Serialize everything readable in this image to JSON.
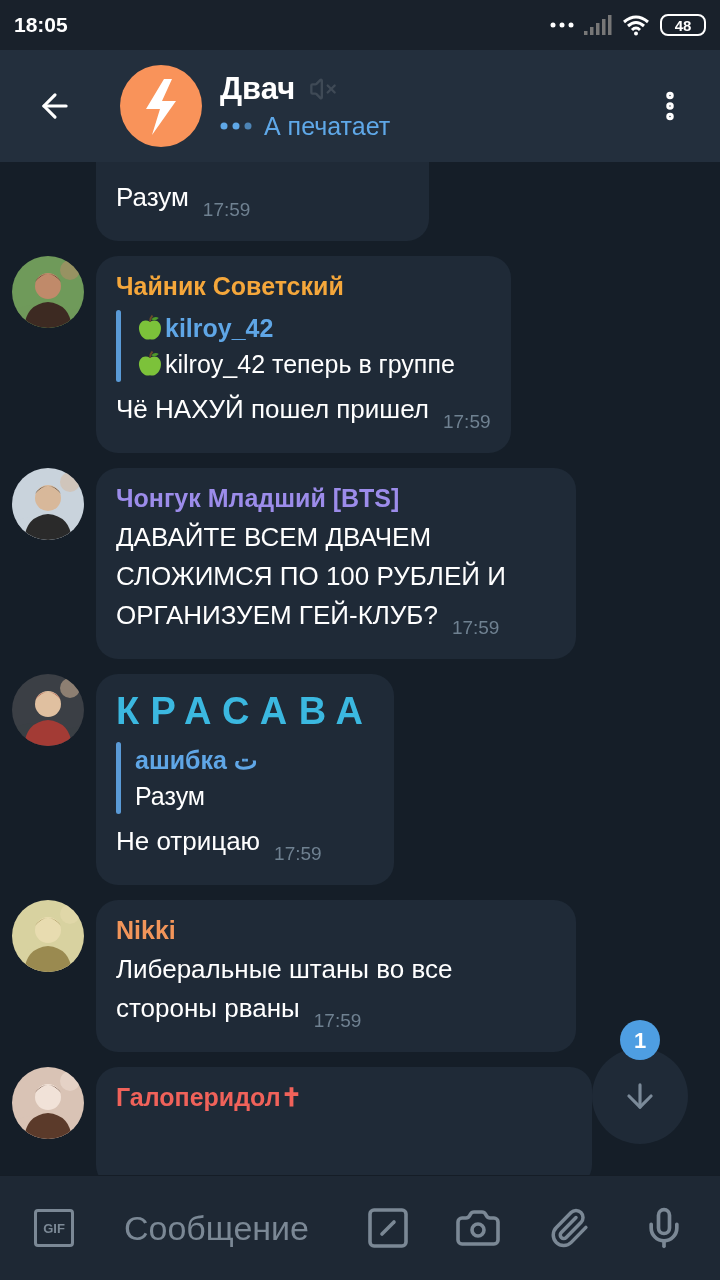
{
  "status_bar": {
    "time": "18:05",
    "battery": "48"
  },
  "header": {
    "title": "Двач",
    "muted": true,
    "status": "А печатает",
    "typing": true
  },
  "messages": [
    {
      "kind": "continuation",
      "text": "Разум",
      "time": "17:59"
    },
    {
      "kind": "message",
      "sender": "Чайник Советский",
      "color": "#f5a73b",
      "spaced": false,
      "reply": {
        "author": "kilroy_42",
        "author_emoji": true,
        "text": "kilroy_42 теперь в группе",
        "text_emoji": true
      },
      "text": "Чё НАХУЙ пошел пришел",
      "time": "17:59"
    },
    {
      "kind": "message",
      "sender": "Чонгук Младший [BTS]",
      "color": "#9c8cea",
      "spaced": false,
      "text": "ДАВАЙТЕ ВСЕМ ДВАЧЕМ СЛОЖИМСЯ ПО 100 РУБЛЕЙ И ОРГАНИЗУЕМ ГЕЙ-КЛУБ?",
      "time": "17:59"
    },
    {
      "kind": "message",
      "sender": "КРАСАВА",
      "color": "#3bb8e0",
      "spaced": true,
      "reply": {
        "author": "ашибка ت",
        "author_emoji": false,
        "text": "Разум",
        "text_emoji": false
      },
      "text": "Не отрицаю",
      "time": "17:59"
    },
    {
      "kind": "message",
      "sender": "Nikki",
      "color": "#f2955a",
      "spaced": false,
      "text": "Либеральные штаны во все стороны рваны",
      "time": "17:59"
    },
    {
      "kind": "cut",
      "sender": "Галоперидол✝",
      "color": "#f0625a",
      "spaced": false
    }
  ],
  "scroll_button": {
    "badge": "1"
  },
  "composer": {
    "gif": "GIF",
    "placeholder": "Сообщение"
  }
}
